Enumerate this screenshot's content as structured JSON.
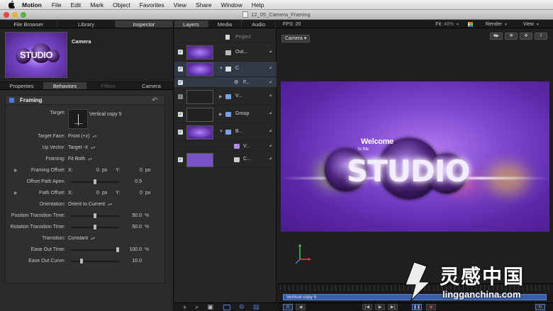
{
  "menubar": {
    "app": "Motion",
    "items": [
      "File",
      "Edit",
      "Mark",
      "Object",
      "Favorites",
      "View",
      "Share",
      "Window",
      "Help"
    ]
  },
  "window": {
    "title": "12_05_Camera_Framing"
  },
  "left_tabs": [
    "File Browser",
    "Library",
    "Inspector"
  ],
  "inspector": {
    "object_name": "Camera",
    "preview_text": "STUDIO",
    "subtabs": [
      "Properties",
      "Behaviors",
      "Filters",
      "Camera"
    ],
    "section": {
      "name": "Framing"
    },
    "params": {
      "target": {
        "label": "Target:",
        "value": "Vertical copy 5"
      },
      "target_face": {
        "label": "Target Face:",
        "value": "Front (+z)"
      },
      "up_vector": {
        "label": "Up Vector:",
        "value": "Target -X"
      },
      "framing": {
        "label": "Framing:",
        "value": "Fit Both"
      },
      "framing_offset": {
        "label": "Framing Offset:",
        "x_label": "X:",
        "x": "0",
        "y_label": "Y:",
        "y": "0",
        "unit": "px"
      },
      "offset_path_apex": {
        "label": "Offset Path Apex:",
        "value": "0.5",
        "level": 0.5
      },
      "path_offset": {
        "label": "Path Offset:",
        "x_label": "X:",
        "x": "0",
        "y_label": "Y:",
        "y": "0",
        "unit": "px"
      },
      "orientation": {
        "label": "Orientation:",
        "value": "Orient to Current"
      },
      "position_transition_time": {
        "label": "Position Transition Time:",
        "value": "50.0",
        "unit": "%",
        "level": 0.5
      },
      "rotation_transition_time": {
        "label": "Rotation Transition Time:",
        "value": "50.0",
        "unit": "%",
        "level": 0.5
      },
      "transition": {
        "label": "Transition:",
        "value": "Constant"
      },
      "ease_out_time": {
        "label": "Ease Out Time:",
        "value": "100.0",
        "unit": "%",
        "level": 1.0
      },
      "ease_out_curve": {
        "label": "Ease Out Curve:",
        "value": "10.0",
        "level": 0.2
      }
    }
  },
  "layers_tabs": [
    "Layers",
    "Media",
    "Audio"
  ],
  "layers": [
    {
      "name": "Project"
    },
    {
      "name": "Out..."
    },
    {
      "name": "C"
    },
    {
      "name": "F..."
    },
    {
      "name": "V..."
    },
    {
      "name": "Group"
    },
    {
      "name": "B..."
    },
    {
      "name": "V..."
    },
    {
      "name": "C..."
    }
  ],
  "canvas": {
    "fps": "FPS: 20",
    "fit_label": "Fit:",
    "fit_value": "48%",
    "render": "Render",
    "view": "View",
    "camera_popup": "Camera",
    "scene": {
      "welcome": "Welcome",
      "to_the": "to the",
      "studio": "STUDIO"
    },
    "timeline_bar": "Vertical copy 5"
  },
  "watermark": {
    "cn": "灵感中国",
    "url": "lingganchina.com"
  },
  "colors": {
    "accent": "#4a7bd8",
    "scene_purple": "#6a34bb"
  }
}
